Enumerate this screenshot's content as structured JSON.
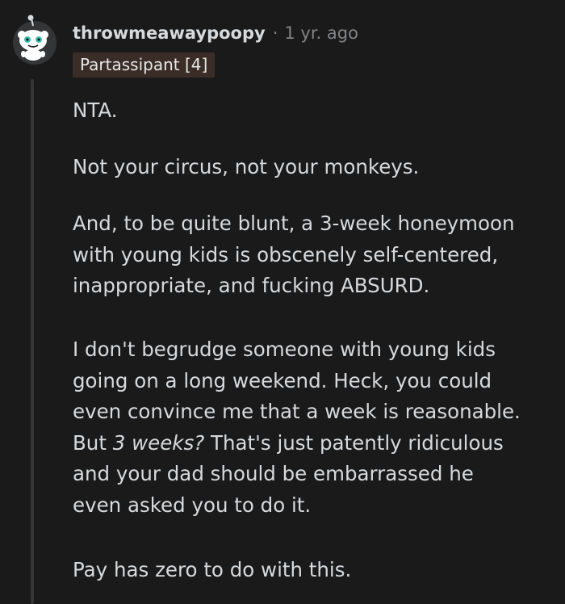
{
  "comment": {
    "username": "throwmeawaypoopy",
    "separator": "·",
    "timestamp": "1 yr. ago",
    "flair": "Partassipant [4]",
    "paragraphs": {
      "p1": "NTA.",
      "p2": "Not your circus, not your monkeys.",
      "p3": {
        "line1": "And, to be quite blunt, a 3-week honeymoon",
        "line2": "with young kids is obscenely self-centered,",
        "line3": "inappropriate, and fucking ABSURD."
      },
      "p4": {
        "line1": "I don't begrudge someone with young kids",
        "line2": "going on a long weekend. Heck, you could",
        "line3": "even convince me that a week is reasonable.",
        "line4_start": "But ",
        "line4_em": "3 weeks?",
        "line4_end": " That's just patently ridiculous",
        "line5": "and your dad should be embarrassed he",
        "line6": "even asked you to do it."
      },
      "p5": "Pay has zero to do with this."
    }
  },
  "colors": {
    "background": "#1a1a1b",
    "text": "#d7dadc",
    "meta": "#818384",
    "flair_bg": "#3a2d27",
    "thread_line": "#343536"
  },
  "icons": {
    "avatar": "snoo-avatar-icon"
  }
}
